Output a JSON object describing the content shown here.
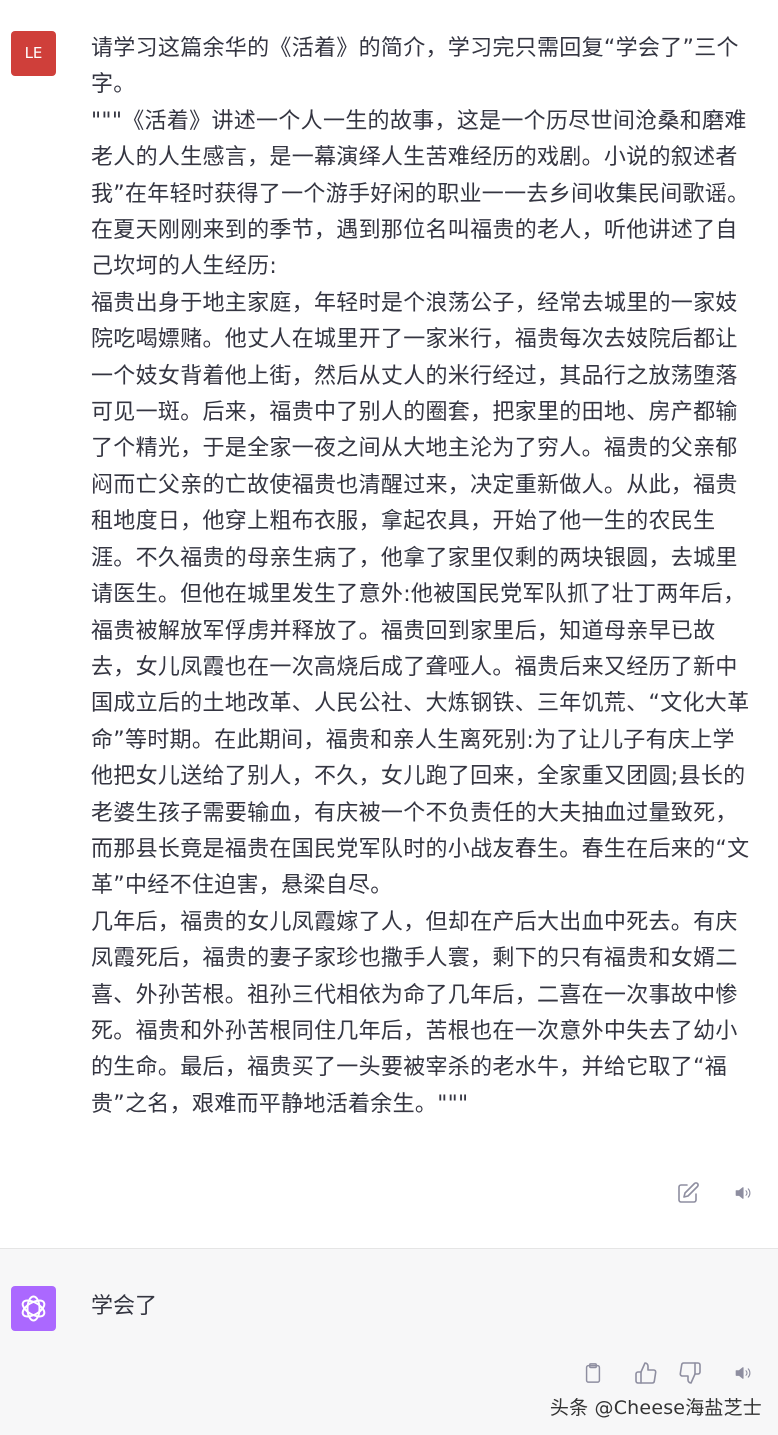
{
  "user_message": {
    "avatar_initials": "LE",
    "avatar_color": "#cf3f3a",
    "text": "请学习这篇余华的《活着》的简介，学习完只需回复“学会了”三个字。\n\"\"\"《活着》讲述一个人一生的故事，这是一个历尽世间沧桑和磨难老人的人生感言，是一幕演绎人生苦难经历的戏剧。小说的叙述者我”在年轻时获得了一个游手好闲的职业一一去乡间收集民间歌谣。在夏天刚刚来到的季节，遇到那位名叫福贵的老人，听他讲述了自己坎坷的人生经历:\n福贵出身于地主家庭，年轻时是个浪荡公子，经常去城里的一家妓院吃喝嫖赌。他丈人在城里开了一家米行，福贵每次去妓院后都让一个妓女背着他上街，然后从丈人的米行经过，其品行之放荡堕落可见一斑。后来，福贵中了别人的圈套，把家里的田地、房产都输了个精光，于是全家一夜之间从大地主沦为了穷人。福贵的父亲郁闷而亡父亲的亡故使福贵也清醒过来，决定重新做人。从此，福贵租地度日，他穿上粗布衣服，拿起农具，开始了他一生的农民生涯。不久福贵的母亲生病了，他拿了家里仅剩的两块银圆，去城里请医生。但他在城里发生了意外:他被国民党军队抓了壮丁两年后，福贵被解放军俘虏并释放了。福贵回到家里后，知道母亲早已故去，女儿凤霞也在一次高烧后成了聋哑人。福贵后来又经历了新中国成立后的土地改革、人民公社、大炼钢铁、三年饥荒、“文化大革命”等时期。在此期间，福贵和亲人生离死别:为了让儿子有庆上学他把女儿送给了别人，不久，女儿跑了回来，全家重又团圆;县长的老婆生孩子需要输血，有庆被一个不负责任的大夫抽血过量致死，而那县长竟是福贵在国民党军队时的小战友春生。春生在后来的“文革”中经不住迫害，悬梁自尽。\n几年后，福贵的女儿凤霞嫁了人，但却在产后大出血中死去。有庆凤霞死后，福贵的妻子家珍也撒手人寰，剩下的只有福贵和女婿二喜、外孙苦根。祖孙三代相依为命了几年后，二喜在一次事故中惨死。福贵和外孙苦根同住几年后，苦根也在一次意外中失去了幼小的生命。最后，福贵买了一头要被宰杀的老水牛，并给它取了“福贵”之名，艰难而平静地活着余生。\"\"\"",
    "actions": [
      "edit-icon",
      "speaker-icon"
    ]
  },
  "assistant_message": {
    "avatar_color": "#ab68ff",
    "avatar_icon": "openai-logo-icon",
    "text": "学会了",
    "actions": [
      "clipboard-icon",
      "thumbs-up-icon",
      "thumbs-down-icon",
      "speaker-icon"
    ]
  },
  "watermark": "头条 @Cheese海盐芝士"
}
